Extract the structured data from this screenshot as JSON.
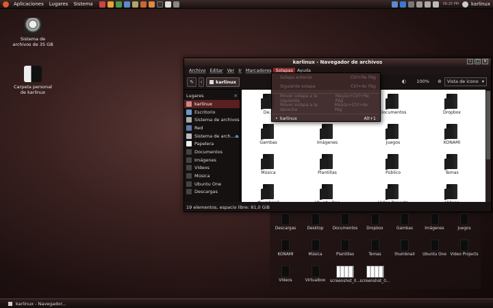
{
  "top_panel": {
    "menus": [
      "Aplicaciones",
      "Lugares",
      "Sistema"
    ],
    "user": "karlinux",
    "clock": "06:25 PM"
  },
  "desktop": {
    "icons": [
      {
        "label": "Sistema de archivos de 35 GB",
        "icon": "hard-drive-icon"
      },
      {
        "label": "Carpeta personal de karlinux",
        "icon": "home-folder-icon"
      }
    ]
  },
  "window": {
    "title": "karlinux - Navegador de archivos",
    "menus": [
      "Archivo",
      "Editar",
      "Ver",
      "Ir",
      "Marcadores",
      "Solapas",
      "Ayuda"
    ],
    "active_menu": "Solapas",
    "crumb": "karlinux",
    "zoom": "100%",
    "view": "Vista de icono",
    "places_label": "Lugares",
    "sidebar": [
      "karlinux",
      "Escritorio",
      "Sistema de archivos",
      "Red",
      "Sistema de arch...",
      "Papelera",
      "Documentos",
      "Imágenes",
      "Vídeos",
      "Música",
      "Ubuntu One",
      "Descargas"
    ],
    "files": [
      "De...",
      "Documentos",
      "Dropbox",
      "Gambas",
      "Imágenes",
      "Juegos",
      "KONAMI",
      "Música",
      "Plantillas",
      "Público",
      "Temas",
      "thumbnail",
      "Ubuntu One",
      "Video Projects",
      "Vídeos"
    ],
    "status": "19 elementos, espacio libre: 81,0 GiB"
  },
  "dropdown": {
    "items": [
      {
        "label": "Solapa anterior",
        "shortcut": "Ctrl+Re Pág",
        "enabled": false
      },
      {
        "label": "Siguiente solapa",
        "shortcut": "Ctrl+Av Pág",
        "enabled": false
      },
      {
        "label": "Mover solapa a la izquierda",
        "shortcut": "Mayús+Ctrl+Re Pág",
        "enabled": false
      },
      {
        "label": "Mover solapa a la derecha",
        "shortcut": "Mayús+Ctrl+Av Pág",
        "enabled": false
      },
      {
        "label": "karlinux",
        "shortcut": "Alt+1",
        "enabled": true
      }
    ]
  },
  "bg_view": {
    "items": [
      "Descargas",
      "Desktop",
      "Documentos",
      "Dropbox",
      "Gambas",
      "Imágenes",
      "Juegos",
      "KONAMI",
      "Música",
      "Plantillas",
      "Temas",
      "thumbnail",
      "Ubuntu One",
      "Video Projects",
      "Vídeos",
      "Virtualbox",
      "screenshot_0...",
      "screenshot_0..."
    ]
  },
  "taskbar": {
    "item": "karlinux - Navegador..."
  }
}
